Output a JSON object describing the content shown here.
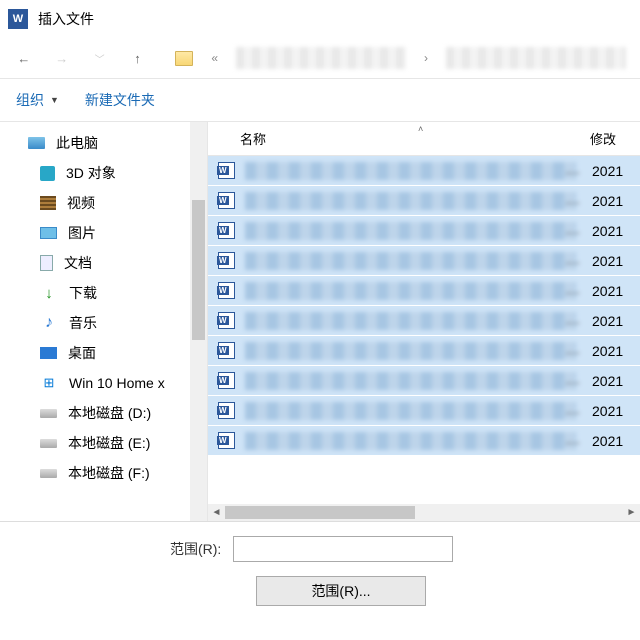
{
  "title": "插入文件",
  "toolbar": {
    "organize": "组织",
    "new_folder": "新建文件夹"
  },
  "columns": {
    "name": "名称",
    "modified": "修改"
  },
  "sidebar": {
    "root": "此电脑",
    "items": [
      {
        "label": "3D 对象",
        "icon": "i-3d"
      },
      {
        "label": "视频",
        "icon": "i-vid"
      },
      {
        "label": "图片",
        "icon": "i-pic"
      },
      {
        "label": "文档",
        "icon": "i-doc"
      },
      {
        "label": "下载",
        "icon": "i-dl"
      },
      {
        "label": "音乐",
        "icon": "i-mus"
      },
      {
        "label": "桌面",
        "icon": "i-desk"
      },
      {
        "label": "Win 10 Home x",
        "icon": "i-win"
      },
      {
        "label": "本地磁盘 (D:)",
        "icon": "i-drv"
      },
      {
        "label": "本地磁盘 (E:)",
        "icon": "i-drv"
      },
      {
        "label": "本地磁盘 (F:)",
        "icon": "i-drv"
      }
    ]
  },
  "files": {
    "year": "2021",
    "count": 10
  },
  "bottom": {
    "range_label": "范围(R):",
    "range_button": "范围(R)..."
  }
}
